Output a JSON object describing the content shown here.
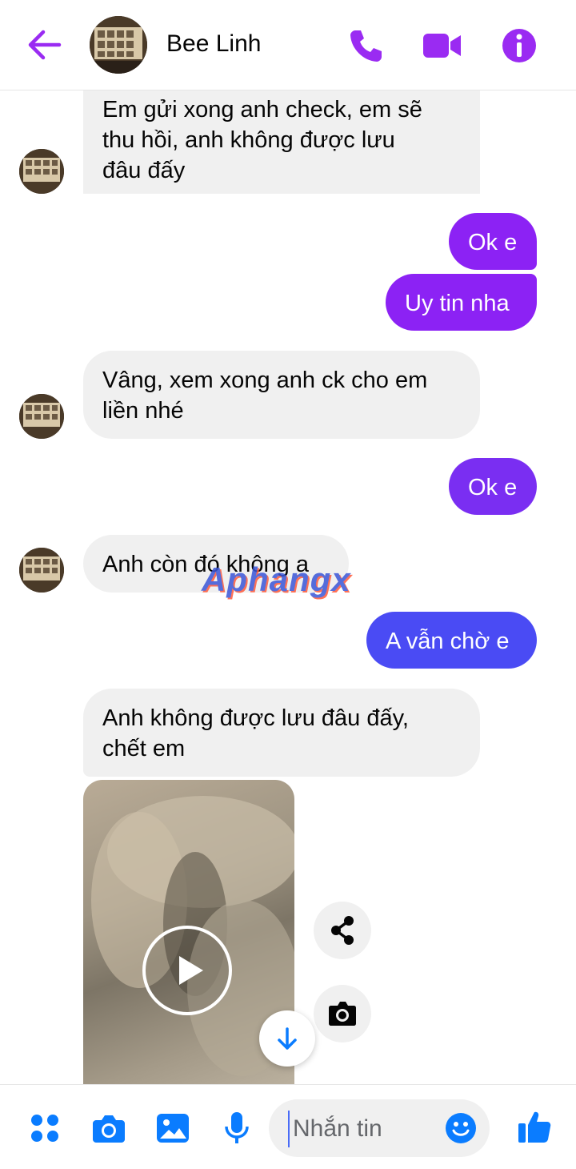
{
  "header": {
    "contact_name": "Bee Linh"
  },
  "messages": [
    {
      "from": "contact",
      "text": "Em gửi xong anh check, em sẽ\nthu hồi, anh không được lưu\nđâu đấy"
    },
    {
      "from": "me",
      "text": "Ok e"
    },
    {
      "from": "me",
      "text": "Uy tin nha"
    },
    {
      "from": "contact",
      "text": "Vâng, xem xong anh ck cho em\nliền nhé"
    },
    {
      "from": "me",
      "text": "Ok e"
    },
    {
      "from": "contact",
      "text": "Anh còn đó không a"
    },
    {
      "from": "me",
      "text": "A vẫn chờ e"
    },
    {
      "from": "contact",
      "text": "Anh không được lưu đâu đấy,\nchết em"
    }
  ],
  "watermark": "Aphangx",
  "composer": {
    "placeholder": "Nhắn tin"
  },
  "colors": {
    "accent": "#9a2bf2",
    "bubble_out_purple": "#8c22f4",
    "bubble_out_blue": "#4a4bf4",
    "bubble_in": "#f0f0f0",
    "composer_icon": "#0a7cff"
  },
  "icons": {
    "header": [
      "back-arrow-icon",
      "phone-icon",
      "video-call-icon",
      "info-icon"
    ],
    "video": [
      "play-icon",
      "share-icon",
      "camera-icon",
      "arrow-down-icon"
    ],
    "composer": [
      "grid-menu-icon",
      "camera-icon",
      "image-icon",
      "microphone-icon",
      "emoji-icon",
      "thumbs-up-icon"
    ]
  }
}
